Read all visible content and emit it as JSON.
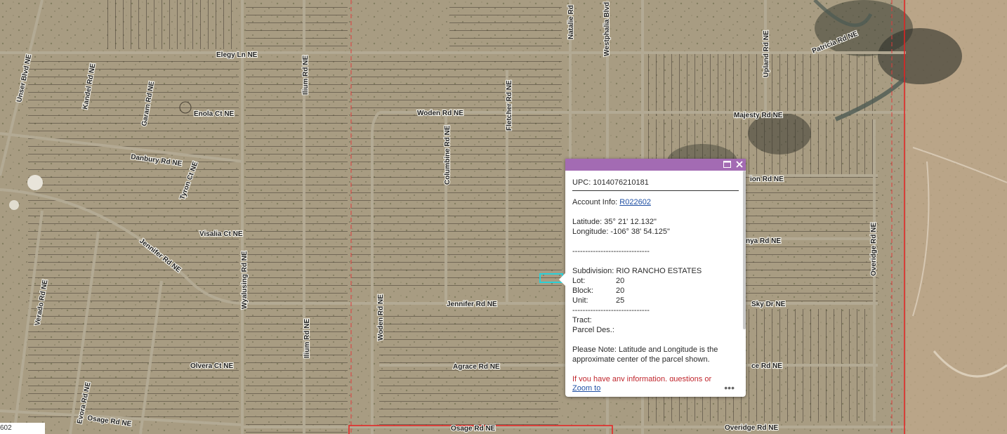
{
  "map": {
    "roads": [
      "Unser Blvd NE",
      "Kandel Rd NE",
      "Garam Rd NE",
      "Elegy Ln NE",
      "Ilium Rd NE",
      "Enola Ct NE",
      "Danbury Rd NE",
      "Tyron Ct NE",
      "Visalia Ct NE",
      "Jennifer Rd NE",
      "Wyalusing Rd NE",
      "Verado Rd NE",
      "Ilium Rd NE",
      "Olvera Ct NE",
      "Evora Rd NE",
      "Osage Rd NE",
      "Woden Rd NE",
      "Woden Rd NE",
      "Columbine Rd NE",
      "Fletcher Rd NE",
      "Jennifer Rd NE",
      "Agrace Rd NE",
      "Osage Rd NE",
      "Natalie Rd",
      "Westphalia Blvd",
      "Upland Rd NE",
      "Patricia Rd NE",
      "Majesty Rd NE",
      "Overidge Rd NE",
      "Overidge Rd NE",
      "Sky Dr NE"
    ],
    "partial_labels": [
      "ion Rd NE",
      "nya Rd NE",
      "ce Rd NE"
    ],
    "scale_fragment": "602"
  },
  "popup": {
    "upc": "UPC: 1014076210181",
    "account_label": "Account Info:",
    "account_link": "R022602",
    "latitude": "Latitude: 35° 21' 12.132\"",
    "longitude": "Longitude: -106° 38' 54.125\"",
    "divider": "------------------------------",
    "subdivision": "Subdivision: RIO RANCHO ESTATES",
    "lot_label": "Lot:",
    "lot_value": "20",
    "block_label": "Block:",
    "block_value": "20",
    "unit_label": "Unit:",
    "unit_value": "25",
    "tract": "Tract:",
    "parcel_des": "Parcel Des.:",
    "note": "Please Note: Latitude and Longitude is the approximate center of the parcel shown.",
    "contact": "If you have any information, questions or",
    "zoom_to": "Zoom to",
    "more": "•••",
    "header_color": "#a36bb3"
  }
}
